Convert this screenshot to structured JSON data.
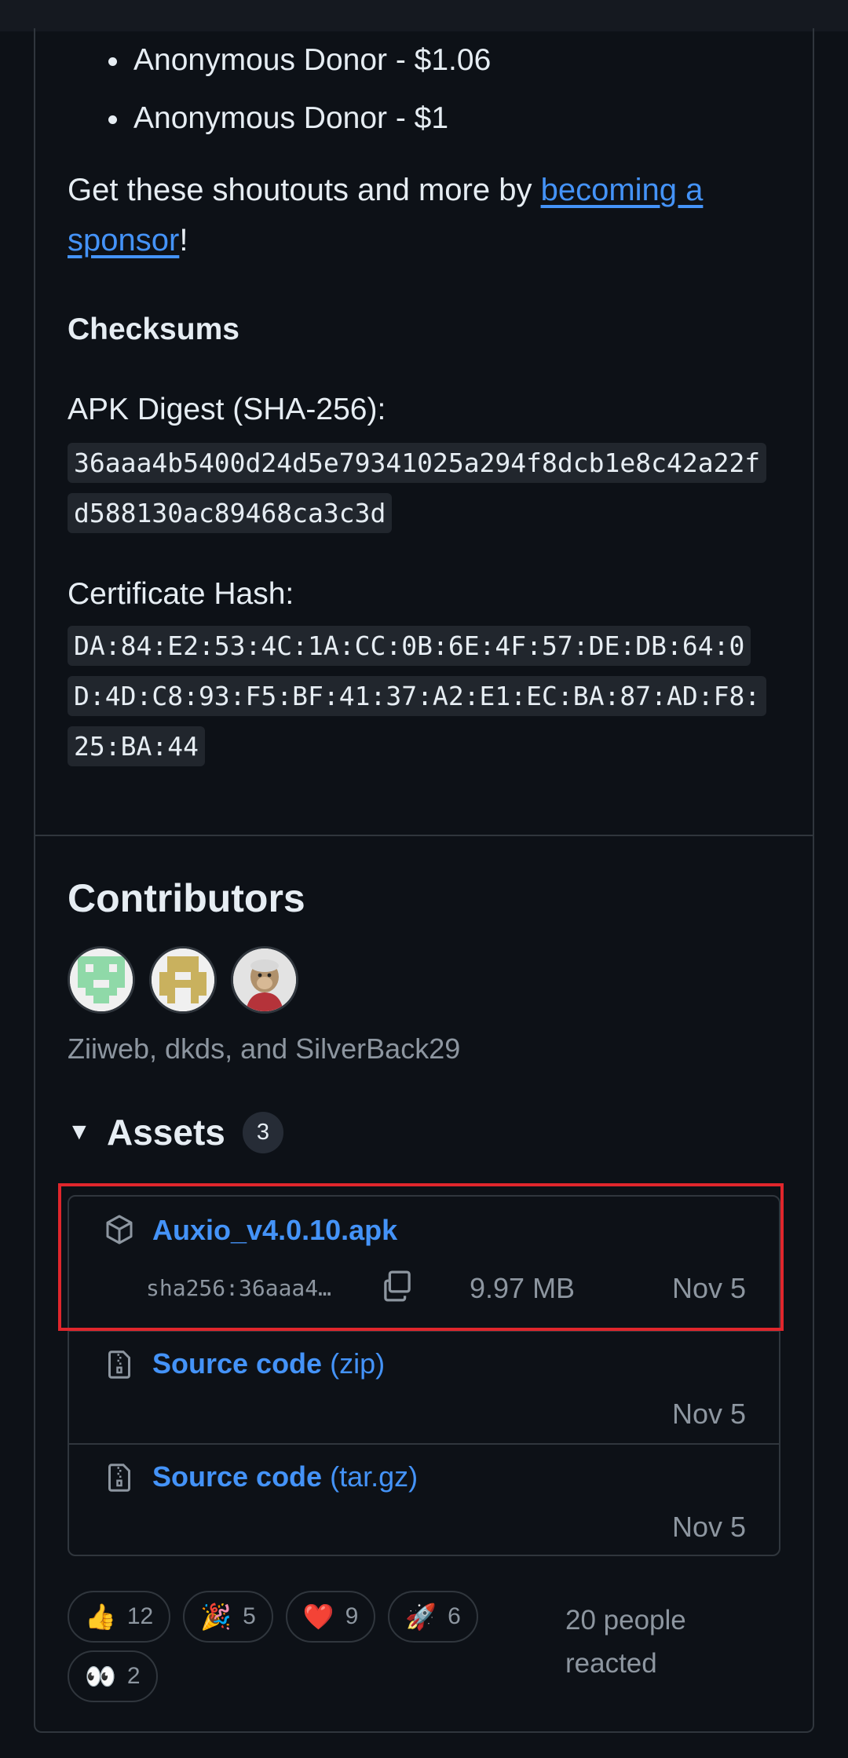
{
  "donors": [
    "Anonymous Donor - $1.06",
    "Anonymous Donor - $1"
  ],
  "sponsor": {
    "prefix": "Get these shoutouts and more by ",
    "link": "becoming a sponsor",
    "suffix": "!"
  },
  "checksums": {
    "heading": "Checksums",
    "apk_label": "APK Digest (SHA-256):",
    "apk_value": "36aaa4b5400d24d5e79341025a294f8dcb1e8c42a22fd588130ac89468ca3c3d",
    "cert_label": "Certificate Hash:",
    "cert_value": "DA:84:E2:53:4C:1A:CC:0B:6E:4F:57:DE:DB:64:0D:4D:C8:93:F5:BF:41:37:A2:E1:EC:BA:87:AD:F8:25:BA:44"
  },
  "contributors": {
    "heading": "Contributors",
    "names": "Ziiweb, dkds, and SilverBack29"
  },
  "assets": {
    "title": "Assets",
    "count": "3",
    "items": [
      {
        "name": "Auxio_v4.0.10.apk",
        "sha": "sha256:36aaa4…",
        "size": "9.97 MB",
        "date": "Nov 5",
        "icon": "package-icon"
      },
      {
        "name": "Source code",
        "ext": "(zip)",
        "date": "Nov 5",
        "icon": "file-zip-icon"
      },
      {
        "name": "Source code",
        "ext": "(tar.gz)",
        "date": "Nov 5",
        "icon": "file-zip-icon"
      }
    ]
  },
  "reactions": {
    "items": [
      {
        "emoji": "👍",
        "count": "12",
        "name": "thumbs-up"
      },
      {
        "emoji": "🎉",
        "count": "5",
        "name": "hooray"
      },
      {
        "emoji": "❤️",
        "count": "9",
        "name": "heart"
      },
      {
        "emoji": "🚀",
        "count": "6",
        "name": "rocket"
      },
      {
        "emoji": "👀",
        "count": "2",
        "name": "eyes"
      }
    ],
    "summary": "20 people reacted"
  },
  "colors": {
    "background": "#0d1117",
    "link": "#4493f8",
    "muted": "#8d96a0",
    "border": "#30363d",
    "highlight": "#e0262c"
  }
}
